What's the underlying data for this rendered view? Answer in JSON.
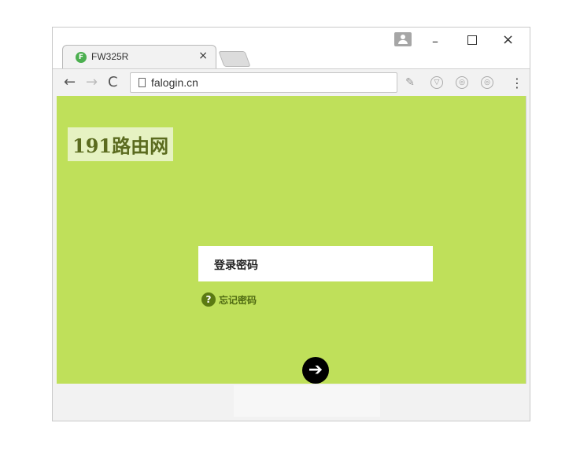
{
  "tab": {
    "title": "FW325R",
    "favicon_letter": "F",
    "close_symbol": "×"
  },
  "window": {
    "minimize": "–",
    "close": "×"
  },
  "toolbar": {
    "back": "←",
    "forward": "→",
    "reload": "C",
    "url": "falogin.cn",
    "menu": "⋮"
  },
  "page": {
    "watermark": "191路由网",
    "password_label": "登录密码",
    "forgot_icon": "?",
    "forgot_text": "忘记密码",
    "submit_symbol": "➔"
  },
  "colors": {
    "page_bg": "#bfe05a",
    "accent_dark": "#5b7a12",
    "submit_bg": "#000000"
  }
}
